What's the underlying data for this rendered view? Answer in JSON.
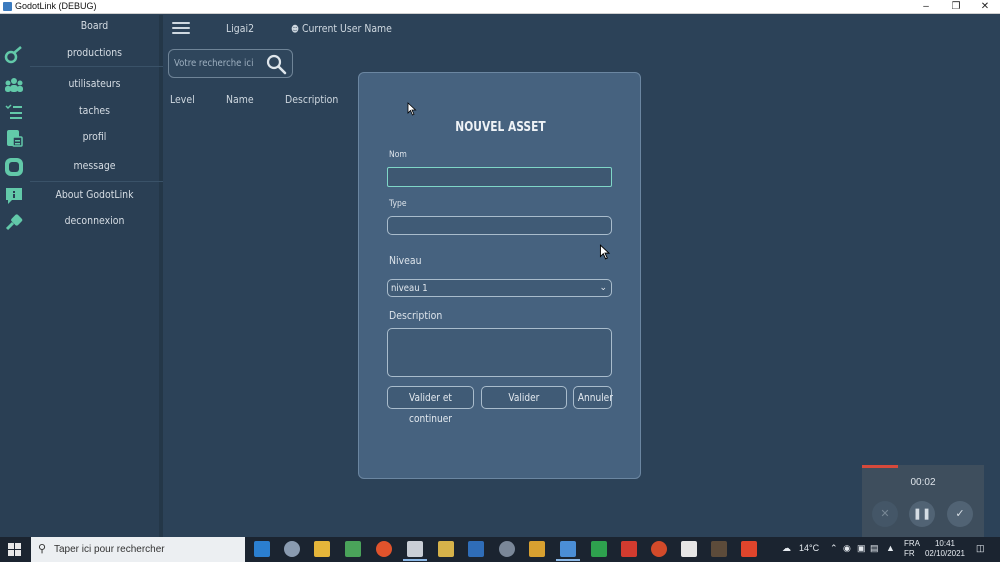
{
  "window": {
    "title": "GodotLink (DEBUG)",
    "minimize": "–",
    "maximize": "❐",
    "close": "✕"
  },
  "sidebar": {
    "items": [
      {
        "label": "Board",
        "icon": "board-icon"
      },
      {
        "label": "productions",
        "icon": "production-icon"
      },
      {
        "label": "utilisateurs",
        "icon": "users-icon"
      },
      {
        "label": "taches",
        "icon": "tasks-icon"
      },
      {
        "label": "profil",
        "icon": "profile-icon"
      },
      {
        "label": "message",
        "icon": "message-icon"
      },
      {
        "label": "About GodotLink",
        "icon": "about-icon"
      },
      {
        "label": "deconnexion",
        "icon": "logout-icon"
      }
    ]
  },
  "header": {
    "project": "Ligai2",
    "user": "Current User Name"
  },
  "search": {
    "placeholder": "Votre recherche ici"
  },
  "table": {
    "columns": [
      "Level",
      "Name",
      "Description"
    ]
  },
  "modal": {
    "title": "NOUVEL ASSET",
    "name_label": "Nom",
    "name_value": "",
    "type_label": "Type",
    "type_value": "",
    "level_label": "Niveau",
    "level_value": "niveau 1",
    "description_label": "Description",
    "description_value": "",
    "buttons": {
      "validate_continue": "Valider et continuer",
      "validate": "Valider",
      "cancel": "Annuler"
    }
  },
  "recorder": {
    "time": "00:02"
  },
  "taskbar": {
    "search_placeholder": "Taper ici pour rechercher",
    "weather": "14°C",
    "language_line1": "FRA",
    "language_line2": "FR",
    "time": "10:41",
    "date": "02/10/2021"
  },
  "colors": {
    "accent": "#7fd6c7",
    "sidebar_icon": "#62c9a9",
    "modal_bg": "#46627f",
    "app_bg": "#2c4258"
  }
}
